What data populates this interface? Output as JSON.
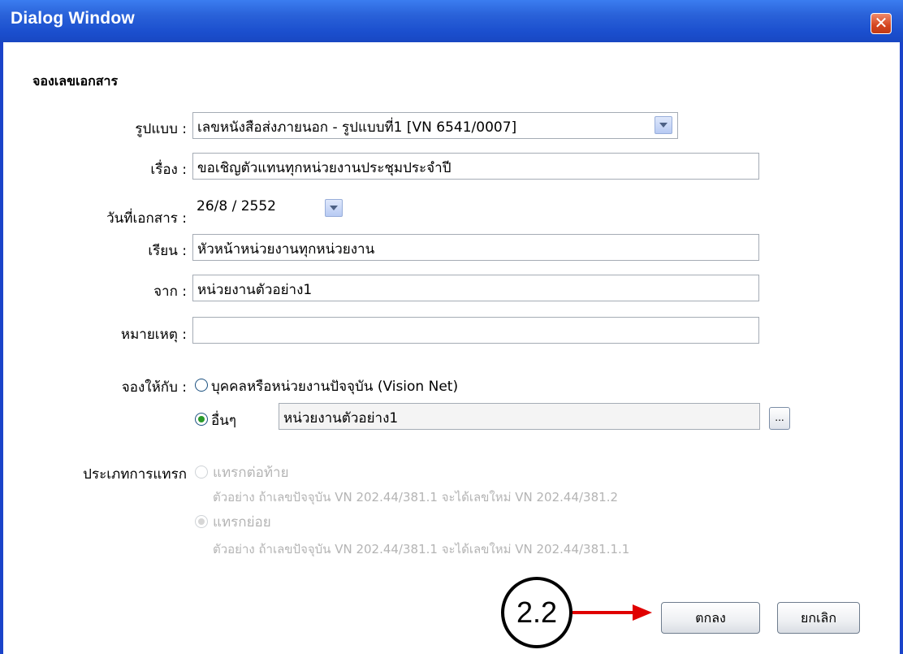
{
  "window": {
    "title": "Dialog Window",
    "close_glyph": "✕"
  },
  "section_title": "จองเลขเอกสาร",
  "form": {
    "format": {
      "label": "รูปแบบ :",
      "value": "เลขหนังสือส่งภายนอก - รูปแบบที่1 [VN 6541/0007]"
    },
    "subject": {
      "label": "เรื่อง :",
      "value": "ขอเชิญตัวแทนทุกหน่วยงานประชุมประจำปี"
    },
    "doc_date": {
      "label": "วันที่เอกสาร :",
      "value": "26/8 / 2552"
    },
    "to": {
      "label": "เรียน :",
      "value": "หัวหน้าหน่วยงานทุกหน่วยงาน"
    },
    "from": {
      "label": "จาก :",
      "value": "หน่วยงานตัวอย่าง1"
    },
    "note": {
      "label": "หมายเหตุ :",
      "value": ""
    },
    "reserve_for": {
      "label": "จองให้กับ :",
      "option_current": "บุคคลหรือหน่วยงานปัจจุบัน (Vision Net)",
      "option_other": "อื่นๆ",
      "other_value": "หน่วยงานตัวอย่าง1",
      "browse_label": "...",
      "selected": "other"
    },
    "insert_type": {
      "label": "ประเภทการแทรก",
      "option_append": "แทรกต่อท้าย",
      "append_example": "ตัวอย่าง ถ้าเลขปัจจุบัน VN 202.44/381.1 จะได้เลขใหม่ VN 202.44/381.2",
      "option_sub": "แทรกย่อย",
      "sub_example": "ตัวอย่าง ถ้าเลขปัจจุบัน VN 202.44/381.1 จะได้เลขใหม่ VN 202.44/381.1.1",
      "selected": "sub",
      "disabled": true
    }
  },
  "buttons": {
    "ok": "ตกลง",
    "cancel": "ยกเลิก"
  },
  "annotation": {
    "step": "2.2"
  },
  "colors": {
    "titlebar": "#1b4fce",
    "close": "#d4451f",
    "annotation_arrow": "#e00000",
    "radio_checked": "#2a9a2a"
  }
}
